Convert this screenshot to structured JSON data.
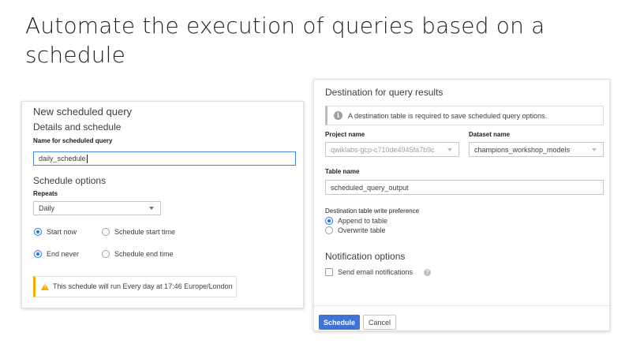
{
  "slide": {
    "title": "Automate the execution of queries based on a schedule"
  },
  "left_panel": {
    "heading": "New scheduled query",
    "details_heading": "Details and schedule",
    "name_label": "Name for scheduled query",
    "name_value": "daily_schedule",
    "schedule_options_heading": "Schedule options",
    "repeats_label": "Repeats",
    "repeats_value": "Daily",
    "start_now_label": "Start now",
    "start_time_label": "Schedule start time",
    "end_never_label": "End never",
    "end_time_label": "Schedule end time",
    "notice_text": "This schedule will run Every day at 17:46 Europe/London"
  },
  "right_panel": {
    "heading": "Destination for query results",
    "info_text": "A destination table is required to save scheduled query options.",
    "project_label": "Project name",
    "project_value": "qwiklabs-gcp-c710de4945fa7b9c",
    "dataset_label": "Dataset name",
    "dataset_value": "champions_workshop_models",
    "table_label": "Table name",
    "table_value": "scheduled_query_output",
    "write_pref_label": "Destination table write preference",
    "append_label": "Append to table",
    "overwrite_label": "Overwrite table",
    "notification_heading": "Notification options",
    "email_label": "Send email notifications",
    "schedule_button": "Schedule",
    "cancel_button": "Cancel"
  },
  "colors": {
    "accent": "#1a73e8",
    "primary_button": "#3f73d6",
    "warning": "#f9ab00"
  },
  "icons": {
    "warning": "warning-icon",
    "info": "info-icon",
    "help": "help-icon"
  }
}
